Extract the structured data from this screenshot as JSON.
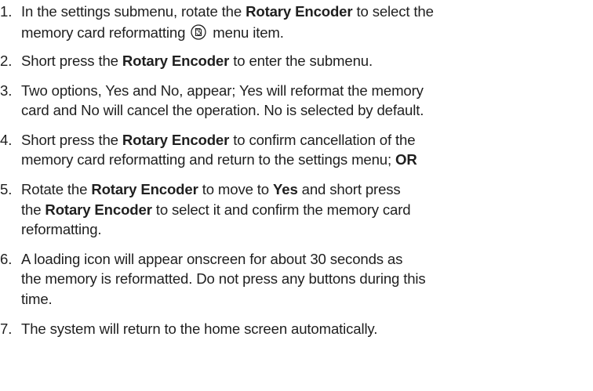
{
  "steps": [
    {
      "number": "1.",
      "line1_a": "In the settings submenu, rotate the ",
      "line1_b": "Rotary Encoder",
      "line1_c": " to select the",
      "line2_a": "memory card reformatting ",
      "icon": "memory-card-format-icon",
      "line2_b": " menu item."
    },
    {
      "number": "2.",
      "a": "Short press the ",
      "b": "Rotary Encoder",
      "c": " to enter the submenu."
    },
    {
      "number": "3.",
      "line1": "Two options, Yes and No, appear; Yes will reformat the memory",
      "line2": "card and No will cancel the operation. No is selected by default."
    },
    {
      "number": "4.",
      "line1_a": "Short press the ",
      "line1_b": "Rotary Encoder",
      "line1_c": " to confirm cancellation of the",
      "line2_a": "memory card reformatting and return to the settings menu; ",
      "line2_b": "OR"
    },
    {
      "number": "5.",
      "line1_a": "Rotate the ",
      "line1_b": "Rotary Encoder",
      "line1_c": " to move to ",
      "line1_d": "Yes",
      "line1_e": " and short press",
      "line2_a": "the ",
      "line2_b": "Rotary Encoder",
      "line2_c": " to select it and confirm the memory card",
      "line3": "reformatting."
    },
    {
      "number": "6.",
      "line1": "A loading icon will appear onscreen for about 30 seconds as",
      "line2": "the memory is reformatted. Do not press any buttons during this",
      "line3": "time."
    },
    {
      "number": "7.",
      "line1": "The system will return to the home screen automatically."
    }
  ]
}
